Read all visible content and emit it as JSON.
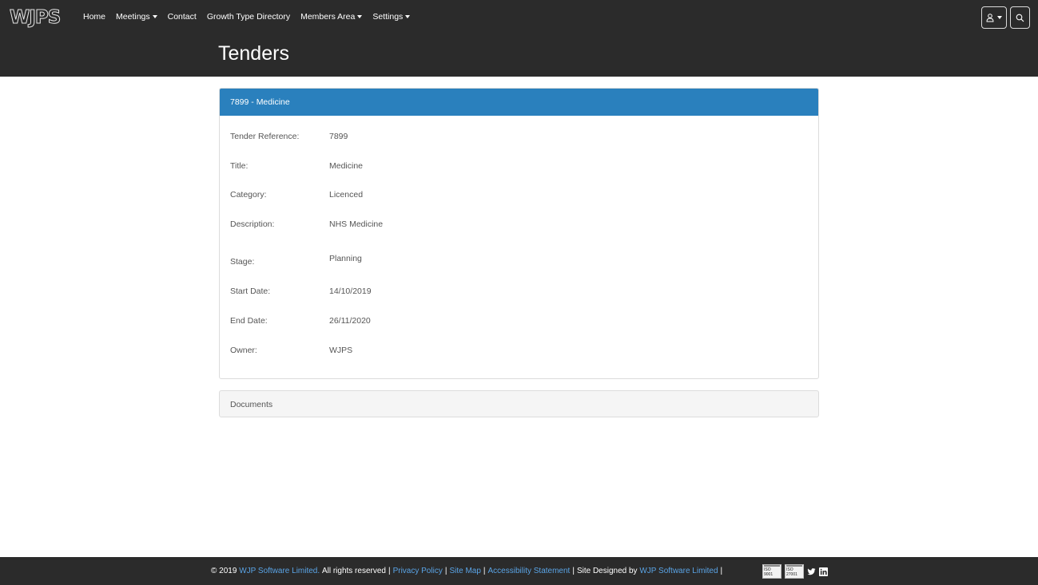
{
  "brand": {
    "logo_text": "WJPS"
  },
  "nav": {
    "items": [
      {
        "label": "Home",
        "dropdown": false
      },
      {
        "label": "Meetings",
        "dropdown": true
      },
      {
        "label": "Contact",
        "dropdown": false
      },
      {
        "label": "Growth Type Directory",
        "dropdown": false
      },
      {
        "label": "Members Area",
        "dropdown": true
      },
      {
        "label": "Settings",
        "dropdown": true
      }
    ],
    "user_icon": "user-icon",
    "search_icon": "search-icon"
  },
  "page": {
    "title": "Tenders"
  },
  "tender": {
    "header": "7899 - Medicine",
    "fields": [
      {
        "label": "Tender Reference:",
        "value": "7899"
      },
      {
        "label": "Title:",
        "value": "Medicine"
      },
      {
        "label": "Category:",
        "value": "Licenced"
      },
      {
        "label": "Description:",
        "value": "NHS Medicine"
      },
      {
        "label": "Stage:",
        "value": "Planning"
      },
      {
        "label": "Start Date:",
        "value": "14/10/2019"
      },
      {
        "label": "End Date:",
        "value": "26/11/2020"
      },
      {
        "label": "Owner:",
        "value": "WJPS"
      }
    ]
  },
  "documents": {
    "label": "Documents"
  },
  "footer": {
    "copyright": "© 2019",
    "company_link": "WJP Software Limited.",
    "rights": "All rights reserved",
    "privacy": "Privacy Policy",
    "sitemap": "Site Map",
    "accessibility": "Accessibility Statement",
    "designed_by": "Site Designed by",
    "designer_link": "WJP Software Limited",
    "iso_badges": [
      "ISO 9001",
      "ISO 27001"
    ],
    "social_icons": [
      "twitter-icon",
      "linkedin-icon"
    ]
  },
  "colors": {
    "navbar_bg": "#2b2b2b",
    "card_header_bg": "#2a80bd",
    "link": "#5aa4e6",
    "panel_bg": "#f5f5f5"
  }
}
